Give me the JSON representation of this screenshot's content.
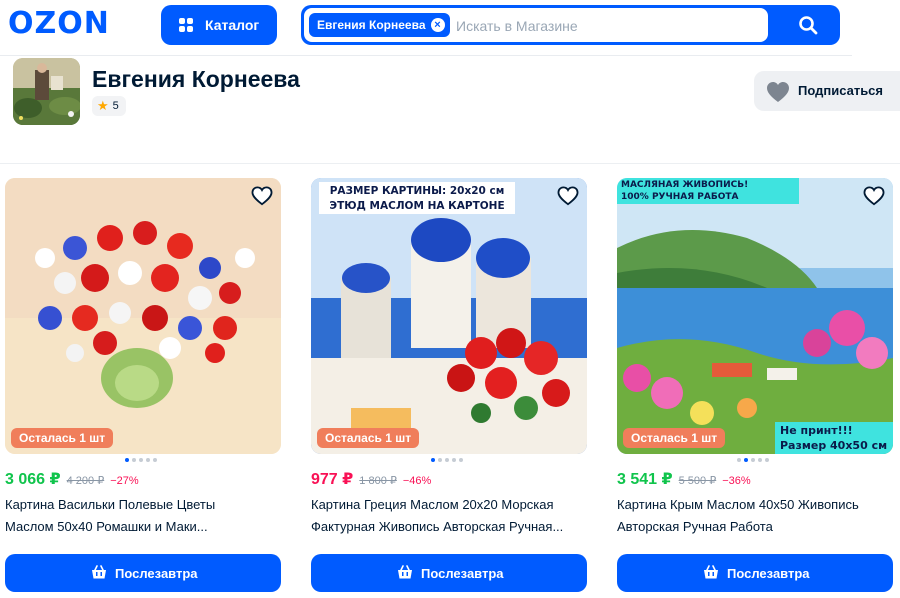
{
  "header": {
    "logo": "OZON",
    "catalog_label": "Каталог",
    "search": {
      "chip": "Евгения Корнеева",
      "chip_close": "×",
      "placeholder": "Искать в Магазине"
    }
  },
  "seller": {
    "name": "Евгения Корнеева",
    "rating": "5",
    "subscribe_label": "Подписаться"
  },
  "products": [
    {
      "stock": "Осталась 1 шт",
      "price": "3 066 ₽",
      "old_price": "4 200 ₽",
      "discount": "−27%",
      "price_color": "#10c44c",
      "title_line1": "Картина Васильки Полевые Цветы",
      "title_line2": "Маслом 50x40 Ромашки и Маки...",
      "button": "Послезавтра",
      "active_dot": 0
    },
    {
      "stock": "Осталась 1 шт",
      "price": "977 ₽",
      "old_price": "1 800 ₽",
      "discount": "−46%",
      "price_color": "#f91155",
      "banner_line1": "РАЗМЕР КАРТИНЫ: 20х20 см",
      "banner_line2": "ЭТЮД МАСЛОМ НА КАРТОНЕ",
      "title_line1": "Картина Греция Маслом 20х20 Морская",
      "title_line2": "Фактурная Живопись Авторская Ручная...",
      "button": "Послезавтра",
      "active_dot": 0
    },
    {
      "stock": "Осталась 1 шт",
      "price": "3 541 ₽",
      "old_price": "5 500 ₽",
      "discount": "−36%",
      "price_color": "#10c44c",
      "banner_top1": "МАСЛЯНАЯ ЖИВОПИСЬ!",
      "banner_top2": "100%  РУЧНАЯ РАБОТА",
      "banner_bottom1": "Не принт!!!",
      "banner_bottom2": "Размер 40х50 см",
      "title_line1": "Картина Крым Маслом 40х50 Живопись",
      "title_line2": "Авторская Ручная Работа",
      "button": "Послезавтра",
      "active_dot": 1
    }
  ],
  "colors": {
    "brand": "#005bff",
    "discount": "#f91155",
    "stock_badge": "#f07e5b",
    "green_price": "#10c44c"
  }
}
